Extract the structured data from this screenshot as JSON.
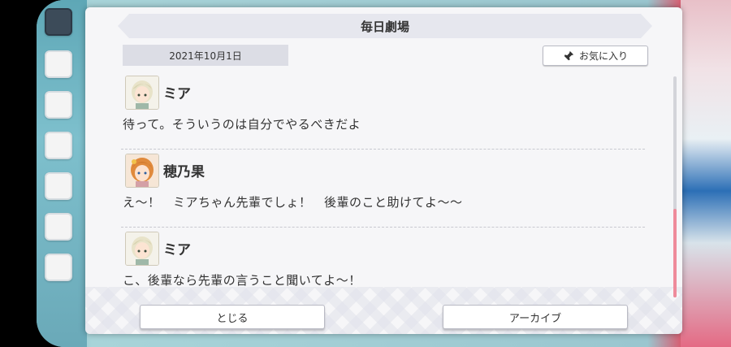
{
  "dialog": {
    "title": "毎日劇場",
    "date": "2021年10月1日",
    "favorite_label": "お気に入り"
  },
  "entries": [
    {
      "speaker": "ミア",
      "text": "待って。そういうのは自分でやるべきだよ",
      "avatar": "mia-avatar"
    },
    {
      "speaker": "穂乃果",
      "text": "え～！　ミアちゃん先輩でしょ！　後輩のこと助けてよ～～",
      "avatar": "honoka-avatar"
    },
    {
      "speaker": "ミア",
      "text": "こ、後輩なら先輩の言うこと聞いてよ～！",
      "avatar": "mia-avatar"
    }
  ],
  "buttons": {
    "close_label": "とじる",
    "archive_label": "アーカイブ"
  },
  "colors": {
    "accent_scroll": "#ee8b9b",
    "panel": "#f6f6f8"
  },
  "scroll": {
    "position_fraction": 0.6
  }
}
